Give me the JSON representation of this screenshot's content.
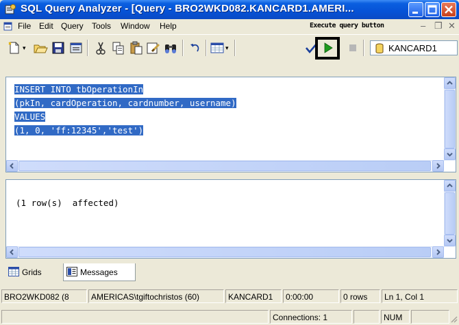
{
  "window": {
    "title": "SQL Query Analyzer - [Query - BRO2WKD082.KANCARD1.AMERI...",
    "icons": {
      "app": "query-analyzer-icon",
      "minimize": "minimize-icon",
      "maximize": "maximize-icon",
      "close": "close-icon"
    }
  },
  "menu": {
    "items": [
      {
        "label": "File"
      },
      {
        "label": "Edit"
      },
      {
        "label": "Query"
      },
      {
        "label": "Tools"
      },
      {
        "label": "Window"
      },
      {
        "label": "Help"
      }
    ],
    "annotation": "Execute query button"
  },
  "toolbar": {
    "icons": [
      "new-query-icon",
      "open-icon",
      "save-icon",
      "load-template-icon",
      "cut-icon",
      "copy-icon",
      "paste-icon",
      "clear-window-icon",
      "find-icon",
      "undo-icon",
      "execute-mode-icon",
      "parse-query-icon",
      "execute-query-icon",
      "cancel-query-icon",
      "database-icon"
    ],
    "database": "KANCARD1"
  },
  "editor": {
    "lines": [
      "INSERT INTO tbOperationIn",
      "(pkIn, cardOperation, cardnumber, username)",
      "VALUES",
      "(1, 0, 'ff:12345','test')"
    ],
    "selection_color": "#316ac5"
  },
  "results": {
    "message": "(1 row(s)  affected)"
  },
  "tabs": [
    {
      "label": "Grids"
    },
    {
      "label": "Messages"
    }
  ],
  "status": {
    "server": "BRO2WKD082 (8",
    "user": "AMERICAS\\tgiftochristos (60)",
    "database": "KANCARD1",
    "elapsed": "0:00:00",
    "rows": "0 rows",
    "position": "Ln 1, Col 1",
    "connections": "Connections: 1",
    "num": "NUM"
  },
  "colors": {
    "titlebar": "#0a5fe0",
    "chrome": "#ece9d8",
    "selection": "#316ac5",
    "execute_green": "#1e9a1e"
  }
}
